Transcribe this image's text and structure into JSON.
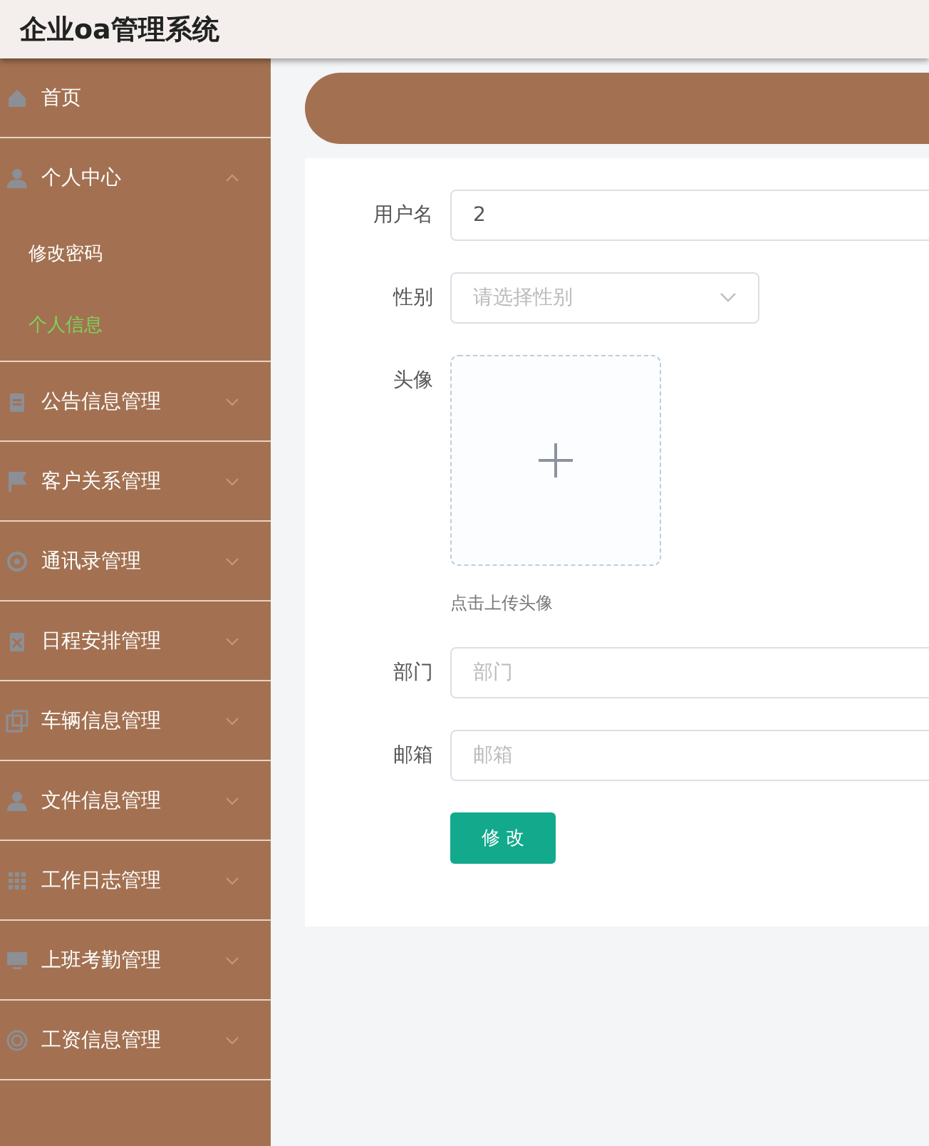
{
  "header": {
    "title": "企业oa管理系统"
  },
  "menu": [
    {
      "label": "首页"
    },
    {
      "label": "个人中心",
      "expanded": true,
      "children": [
        {
          "label": "修改密码",
          "selected": false
        },
        {
          "label": "个人信息",
          "selected": true
        }
      ]
    },
    {
      "label": "公告信息管理",
      "expanded": false
    },
    {
      "label": "客户关系管理",
      "expanded": false
    },
    {
      "label": "通讯录管理",
      "expanded": false
    },
    {
      "label": "日程安排管理",
      "expanded": false
    },
    {
      "label": "车辆信息管理",
      "expanded": false
    },
    {
      "label": "文件信息管理",
      "expanded": false
    },
    {
      "label": "工作日志管理",
      "expanded": false
    },
    {
      "label": "上班考勤管理",
      "expanded": false
    },
    {
      "label": "工资信息管理",
      "expanded": false
    }
  ],
  "form": {
    "fields": [
      {
        "kind": "text",
        "label": "用户名",
        "value": "2"
      },
      {
        "kind": "select",
        "label": "性别",
        "placeholder": "请选择性别"
      },
      {
        "kind": "upload",
        "label": "头像",
        "hint": "点击上传头像"
      },
      {
        "kind": "text",
        "label": "部门",
        "placeholder": "部门"
      },
      {
        "kind": "text",
        "label": "邮箱",
        "placeholder": "邮箱"
      }
    ],
    "submit": "修 改"
  }
}
